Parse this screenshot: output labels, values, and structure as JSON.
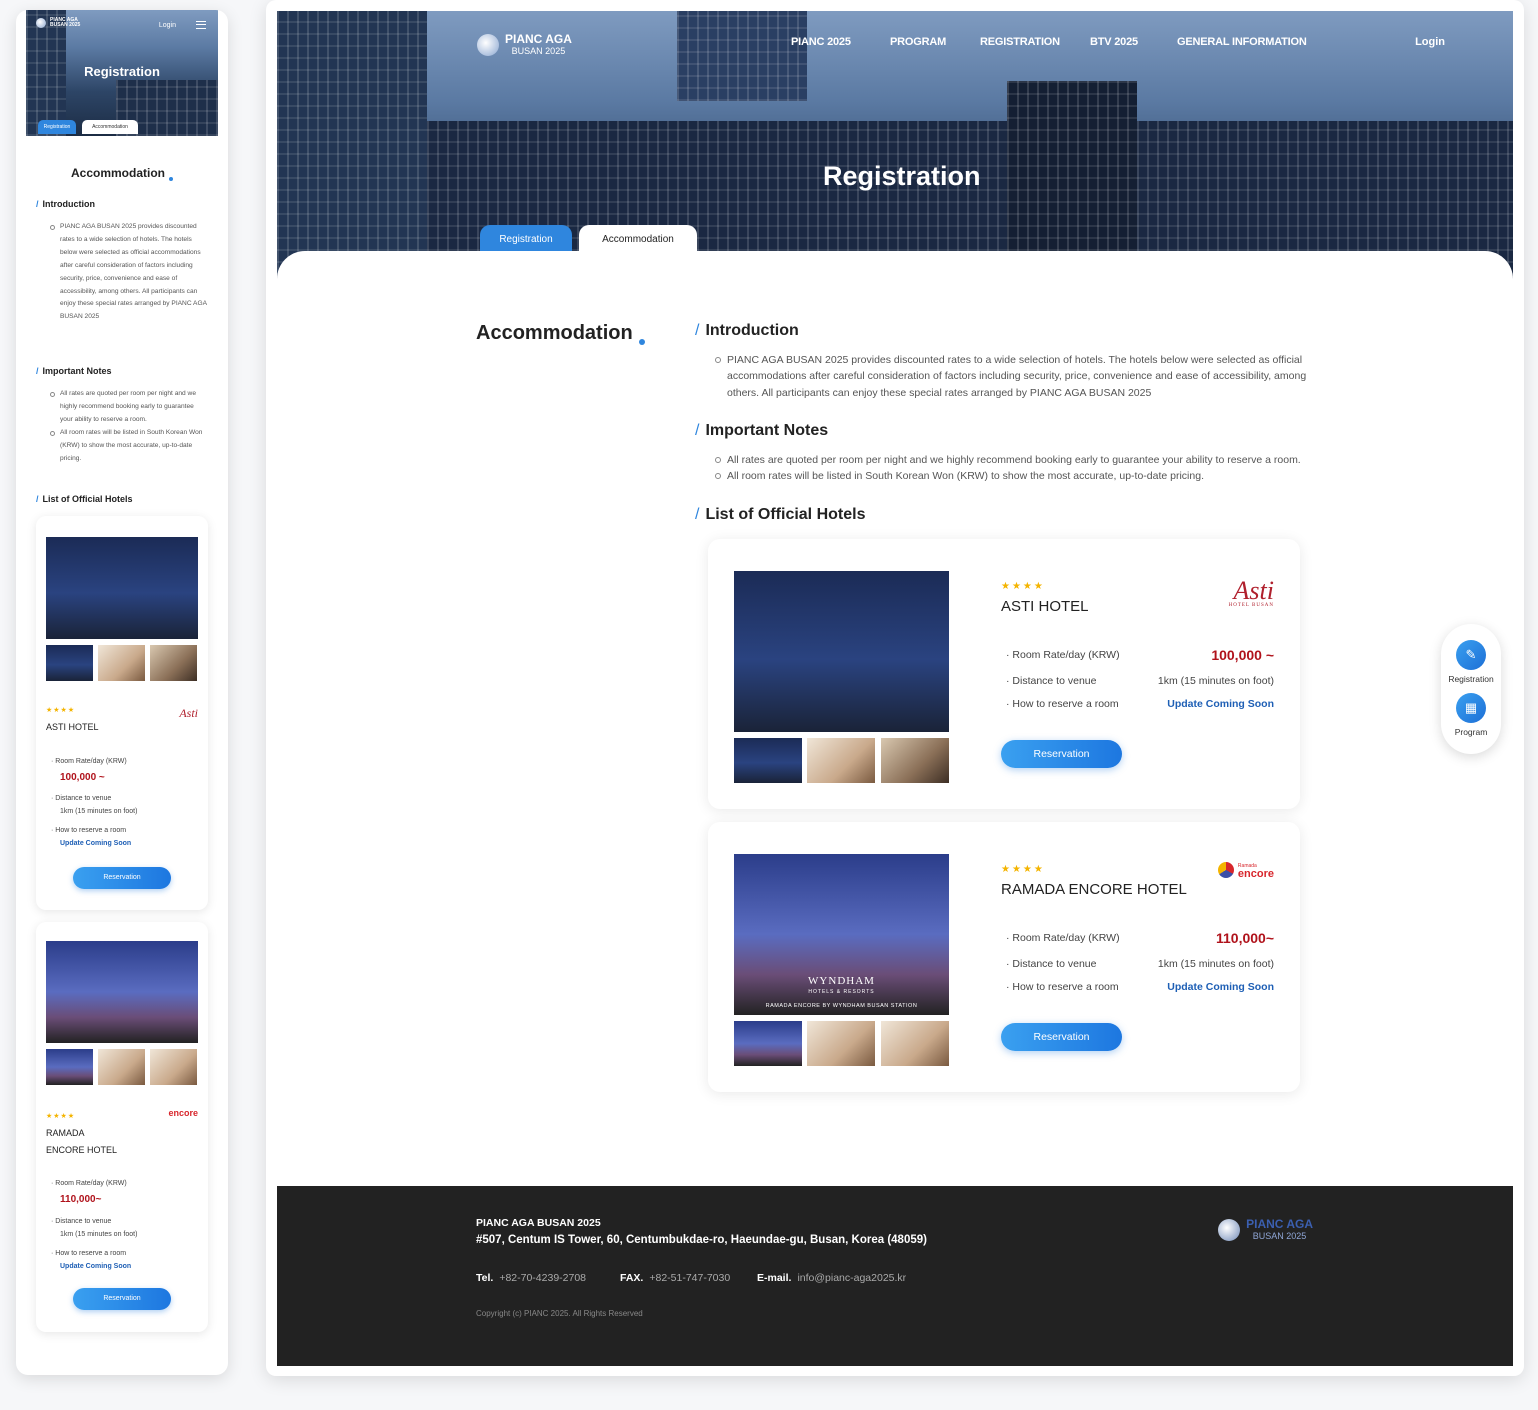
{
  "site": {
    "logo_line1": "PIANC AGA",
    "logo_line2": "BUSAN 2025",
    "nav": [
      "PIANC 2025",
      "PROGRAM",
      "REGISTRATION",
      "BTV 2025",
      "GENERAL INFORMATION"
    ],
    "login": "Login",
    "hero_title": "Registration",
    "tabs": [
      "Registration",
      "Accommodation"
    ],
    "active_tab": "Accommodation"
  },
  "page": {
    "heading": "Accommodation",
    "sections": {
      "intro_title": "Introduction",
      "intro_items": [
        "PIANC AGA BUSAN 2025 provides discounted rates to a wide selection of hotels. The hotels below were selected as official accommodations after careful consideration of factors including security, price, convenience and ease of accessibility, among others. All participants can enjoy these special rates arranged by PIANC AGA BUSAN 2025"
      ],
      "notes_title": "Important Notes",
      "notes_items": [
        "All rates are quoted per room per night and we highly recommend booking early to guarantee your ability to reserve a room.",
        "All room rates will be listed in South Korean Won (KRW) to show the most accurate, up-to-date pricing."
      ],
      "hotels_title": "List of Official Hotels"
    }
  },
  "hotels": [
    {
      "name": "ASTI HOTEL",
      "stars": "★★★★",
      "logo_text": "Asti",
      "logo_sub": "HOTEL BUSAN",
      "rate_label": "· Room Rate/day (KRW)",
      "rate": "100,000 ~",
      "distance_label": "· Distance to venue",
      "distance": "1km (15 minutes on foot)",
      "reserve_label": "· How to reserve a room",
      "reserve": "Update Coming Soon",
      "button": "Reservation"
    },
    {
      "name": "RAMADA ENCORE HOTEL",
      "stars": "★★★★",
      "logo_text": "encore",
      "logo_sub": "Ramada",
      "image_caption1": "WYNDHAM",
      "image_caption2": "HOTELS & RESORTS",
      "image_caption3": "RAMADA ENCORE BY WYNDHAM BUSAN STATION",
      "rate_label": "· Room Rate/day (KRW)",
      "rate": "110,000~",
      "distance_label": "· Distance to venue",
      "distance": "1km (15 minutes on foot)",
      "reserve_label": "· How to reserve a room",
      "reserve": "Update Coming Soon",
      "button": "Reservation"
    }
  ],
  "mobile": {
    "hotel2_name_line1": "RAMADA",
    "hotel2_name_line2": "ENCORE HOTEL",
    "rate_label": "· Room Rate/day (KRW)",
    "distance_label": "· Distance to venue",
    "reserve_label": "· How to reserve a room"
  },
  "quick_menu": [
    {
      "label": "Registration",
      "icon": "edit-icon"
    },
    {
      "label": "Program",
      "icon": "calendar-icon"
    }
  ],
  "footer": {
    "org": "PIANC AGA BUSAN 2025",
    "address": "#507, Centum IS Tower, 60, Centumbukdae-ro, Haeundae-gu, Busan, Korea (48059)",
    "tel_label": "Tel.",
    "tel": "+82-70-4239-2708",
    "fax_label": "FAX.",
    "fax": "+82-51-747-7030",
    "email_label": "E-mail.",
    "email": "info@pianc-aga2025.kr",
    "copyright": "Copyright (c) PIANC 2025. All Rights Reserved"
  },
  "colors": {
    "accent": "#2f86de",
    "price": "#b0121b",
    "link": "#1e5fb5",
    "star": "#f4b400",
    "footer_bg": "#222222"
  }
}
